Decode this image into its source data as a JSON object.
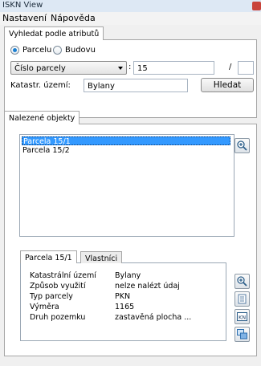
{
  "window": {
    "title": "ISKN View"
  },
  "menu": {
    "items": [
      "Nastavení",
      "Nápověda"
    ]
  },
  "search": {
    "tab_label": "Vyhledat podle atributů",
    "radio_parcel": "Parcelu",
    "radio_building": "Budovu",
    "attribute_select": "Číslo parcely",
    "colon": ":",
    "number_value": "15",
    "slash": "/",
    "sub_number_value": "",
    "cadastral_label": "Katastr. území:",
    "cadastral_value": "Bylany",
    "search_button": "Hledat"
  },
  "results": {
    "tab_label": "Nalezené objekty",
    "items": [
      "Parcela 15/1",
      "Parcela 15/2"
    ],
    "selected_index": 0
  },
  "detail": {
    "tabs": [
      "Parcela 15/1",
      "Vlastníci"
    ],
    "properties": [
      {
        "key": "Katastrální území",
        "value": "Bylany"
      },
      {
        "key": "Způsob využití",
        "value": "nelze nalézt údaj"
      },
      {
        "key": "Typ parcely",
        "value": "PKN"
      },
      {
        "key": "Výměra",
        "value": "1165"
      },
      {
        "key": "Druh pozemku",
        "value": "zastavěná plocha ..."
      }
    ]
  },
  "icons": {
    "zoom": "zoom-in-icon",
    "document": "document-icon",
    "kn": "kn-icon",
    "windows": "windows-icon"
  }
}
